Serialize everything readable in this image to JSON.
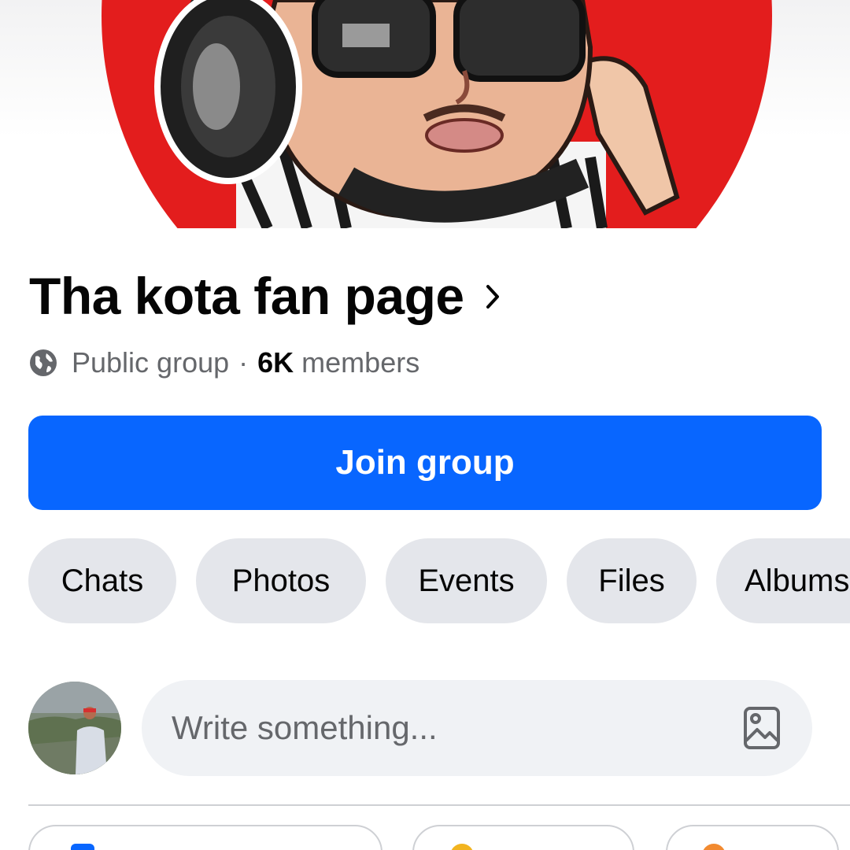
{
  "group": {
    "name": "Tha kota fan page",
    "privacy": "Public group",
    "separator": "·",
    "member_count": "6K",
    "members_label": "members"
  },
  "actions": {
    "join_label": "Join group"
  },
  "tabs": [
    {
      "label": "Chats"
    },
    {
      "label": "Photos"
    },
    {
      "label": "Events"
    },
    {
      "label": "Files"
    },
    {
      "label": "Albums"
    }
  ],
  "composer": {
    "placeholder": "Write something..."
  },
  "colors": {
    "primary": "#0866ff",
    "chip_bg": "#e4e6eb",
    "secondary_text": "#65676b",
    "cover_red": "#e31d1d"
  },
  "icons": {
    "title_chevron": "chevron-right-icon",
    "privacy": "globe-icon",
    "composer_photo": "photo-icon"
  }
}
